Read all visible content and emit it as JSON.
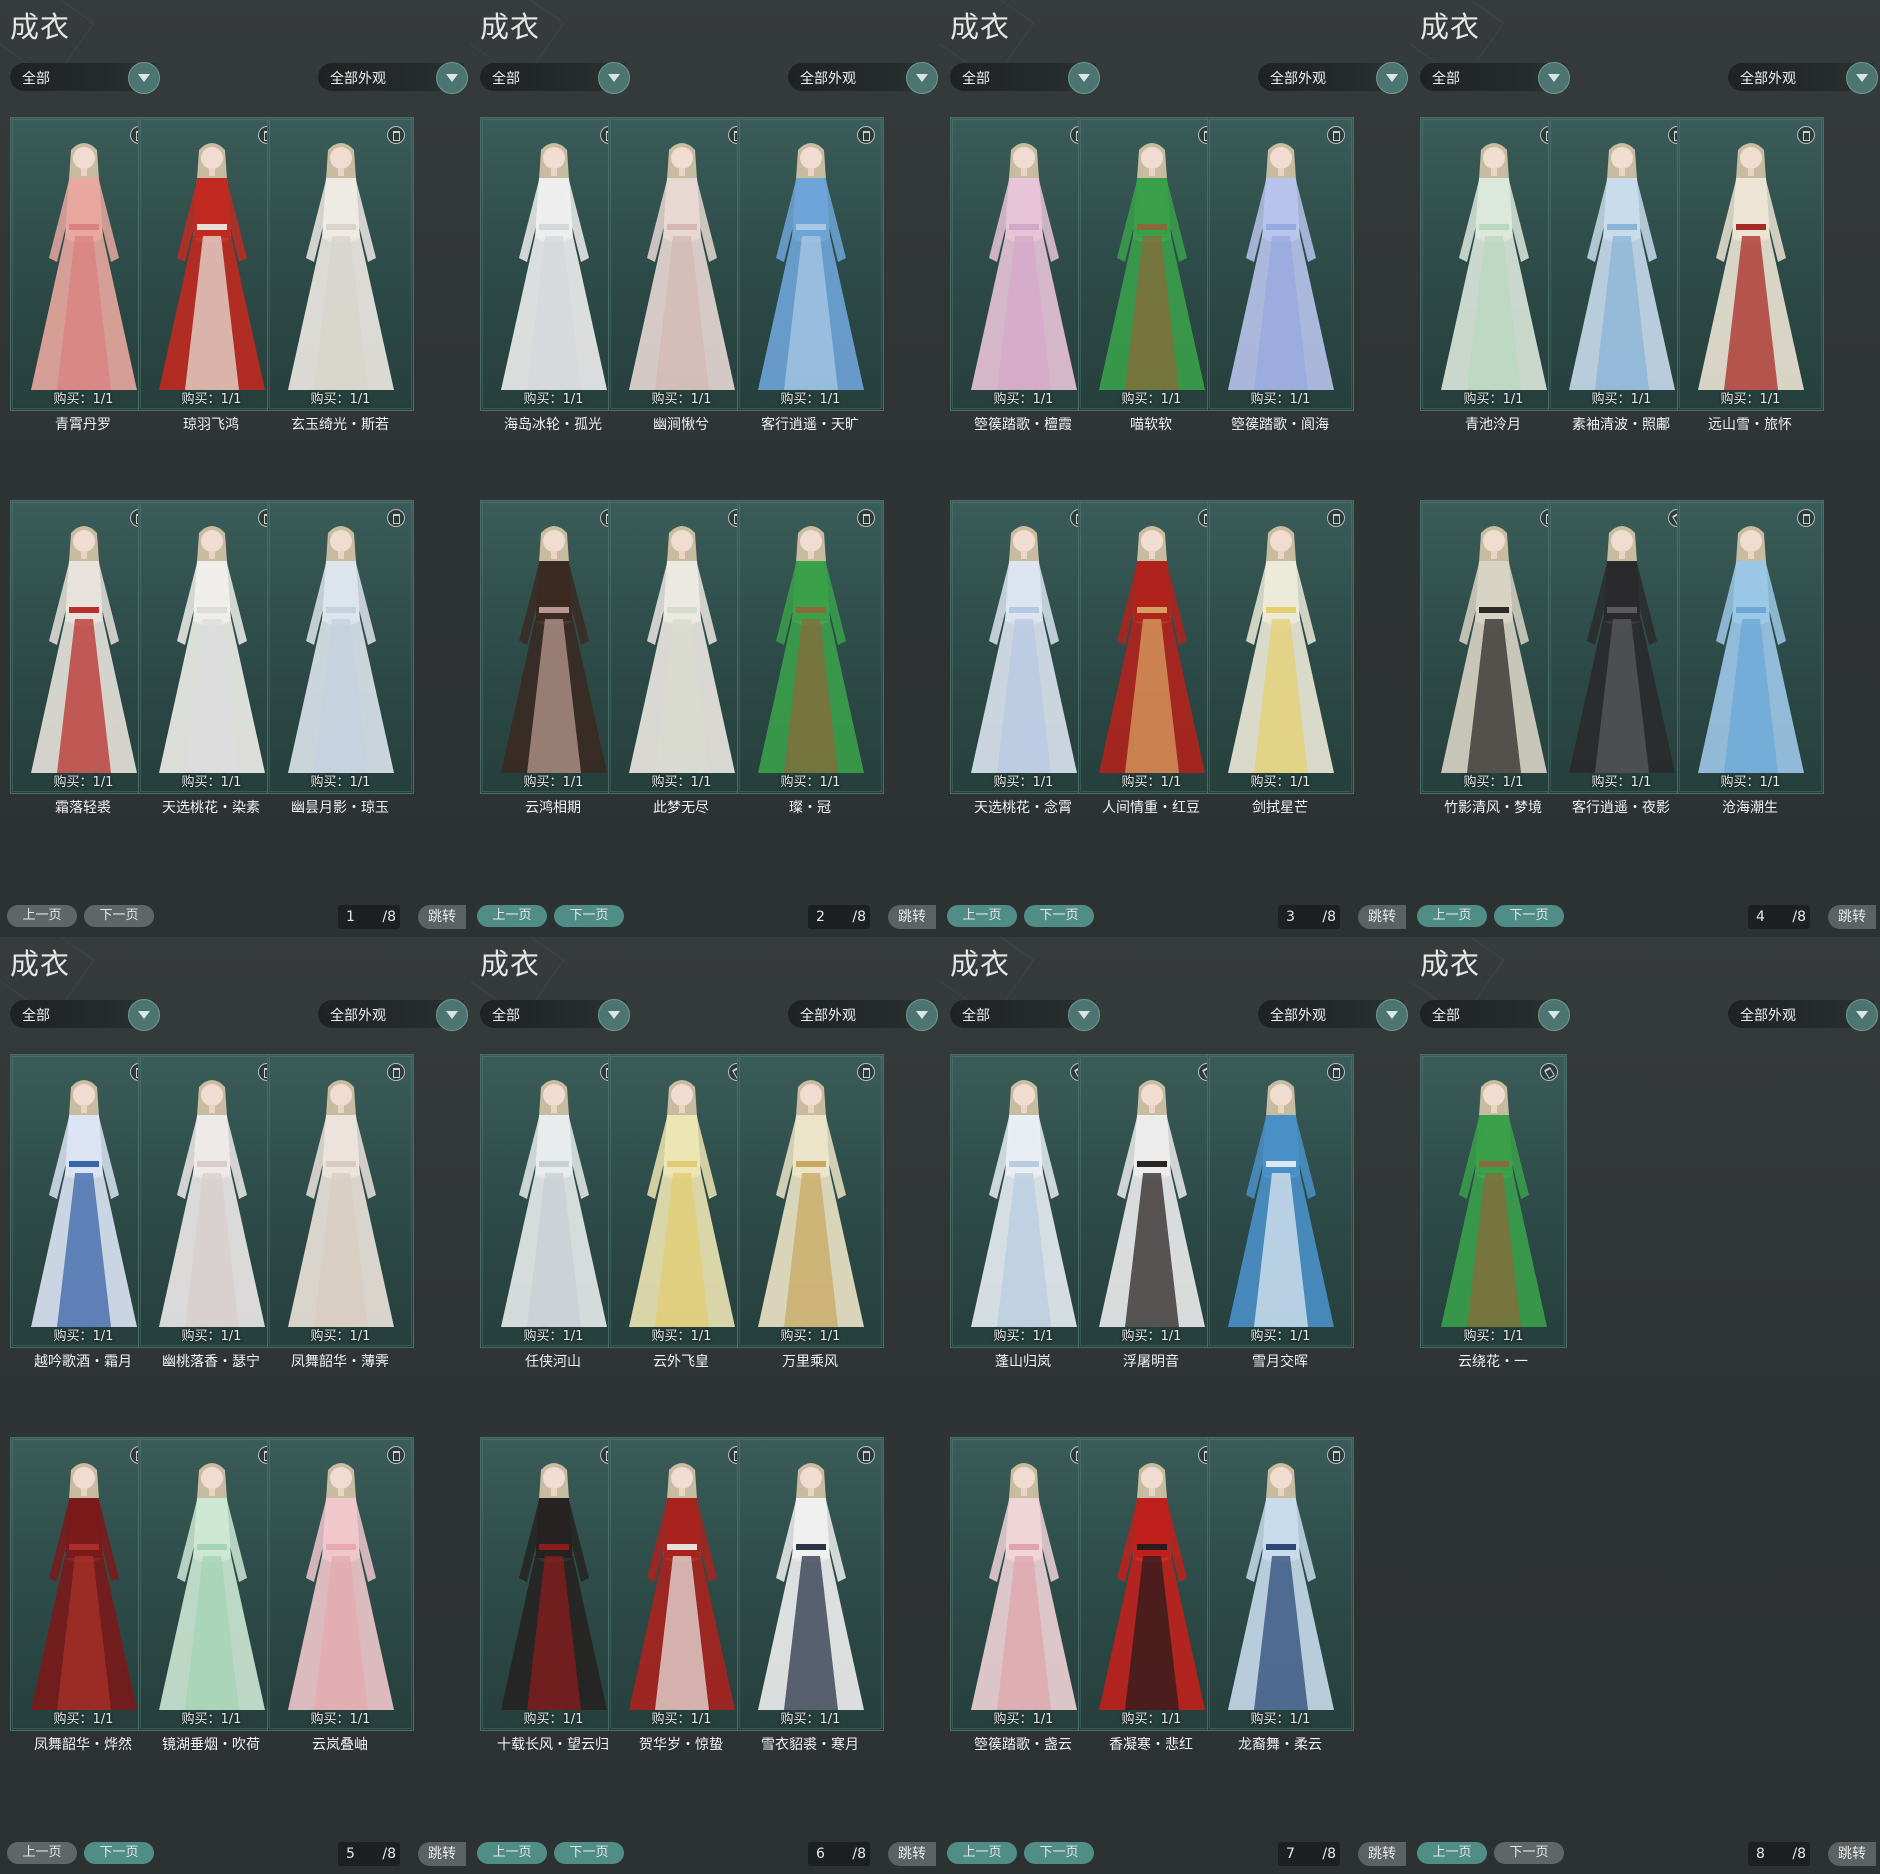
{
  "panels": [
    {
      "title": "成衣",
      "filter_type": "全部",
      "filter_look": "全部外观",
      "page": "1",
      "total": "/8",
      "prev": "上一页",
      "next": "下一页",
      "jump": "跳转",
      "items": [
        {
          "name": "青霄丹罗",
          "buy": "购买：1/1",
          "colors": [
            "#e8a8a0",
            "#d98080"
          ]
        },
        {
          "name": "琼羽飞鸿",
          "buy": "购买：1/1",
          "colors": [
            "#c02a20",
            "#e8e0d8"
          ]
        },
        {
          "name": "玄玉绮光・斯若",
          "buy": "购买：1/1",
          "colors": [
            "#eeeae4",
            "#d8d4cc"
          ]
        },
        {
          "name": "霜落轻裘",
          "buy": "购买：1/1",
          "colors": [
            "#e8e2dc",
            "#b8302c"
          ]
        },
        {
          "name": "天选桃花・染素",
          "buy": "购买：1/1",
          "colors": [
            "#f0eeea",
            "#dcdcdc"
          ]
        },
        {
          "name": "幽昙月影・琼玉",
          "buy": "购买：1/1",
          "colors": [
            "#dce4ec",
            "#c4d2e0"
          ]
        }
      ]
    },
    {
      "title": "成衣",
      "filter_type": "全部",
      "filter_look": "全部外观",
      "page": "2",
      "total": "/8",
      "prev": "上一页",
      "next": "下一页",
      "jump": "跳转",
      "items": [
        {
          "name": "海岛冰轮・孤光",
          "buy": "购买：1/1",
          "colors": [
            "#eeeeee",
            "#d4d8dc"
          ]
        },
        {
          "name": "幽涧愀兮",
          "buy": "购买：1/1",
          "colors": [
            "#e8d8d4",
            "#d4b8b4"
          ]
        },
        {
          "name": "客行逍遥・天旷",
          "buy": "购买：1/1",
          "colors": [
            "#6ea4d8",
            "#a8c8e4"
          ]
        },
        {
          "name": "云鸿相期",
          "buy": "购买：1/1",
          "colors": [
            "#3a2a22",
            "#b89890"
          ]
        },
        {
          "name": "此梦无尽",
          "buy": "购买：1/1",
          "colors": [
            "#ece8e2",
            "#d8dcd0"
          ]
        },
        {
          "name": "璨・冠",
          "buy": "购买：1/1",
          "colors": [
            "#3aa04a",
            "#8a6a3a"
          ]
        }
      ]
    },
    {
      "title": "成衣",
      "filter_type": "全部",
      "filter_look": "全部外观",
      "page": "3",
      "total": "/8",
      "prev": "上一页",
      "next": "下一页",
      "jump": "跳转",
      "items": [
        {
          "name": "箜篌踏歌・檀霞",
          "buy": "购买：1/1",
          "colors": [
            "#e8c4d8",
            "#d4a8c8"
          ]
        },
        {
          "name": "喵软软",
          "buy": "购买：1/1",
          "colors": [
            "#3aa04a",
            "#8a6a3a"
          ]
        },
        {
          "name": "箜篌踏歌・阆海",
          "buy": "购买：1/1",
          "colors": [
            "#b8c4ec",
            "#98a8e0"
          ]
        },
        {
          "name": "天选桃花・念霄",
          "buy": "购买：1/1",
          "colors": [
            "#dce4f0",
            "#b8c8e4"
          ]
        },
        {
          "name": "人间情重・红豆",
          "buy": "购买：1/1",
          "colors": [
            "#b0221c",
            "#d8a060"
          ]
        },
        {
          "name": "剑拭星芒",
          "buy": "购买：1/1",
          "colors": [
            "#ecead8",
            "#e4d070"
          ]
        }
      ]
    },
    {
      "title": "成衣",
      "filter_type": "全部",
      "filter_look": "全部外观",
      "page": "4",
      "total": "/8",
      "prev": "上一页",
      "next": "下一页",
      "jump": "跳转",
      "items": [
        {
          "name": "青池泠月",
          "buy": "购买：1/1",
          "colors": [
            "#dce8dc",
            "#b8d8c0"
          ]
        },
        {
          "name": "素袖清波・照鄘",
          "buy": "购买：1/1",
          "colors": [
            "#c8dcec",
            "#8ab4d8"
          ]
        },
        {
          "name": "远山雪・旅怀",
          "buy": "购买：1/1",
          "colors": [
            "#ece4d4",
            "#a82a24"
          ]
        },
        {
          "name": "竹影清风・梦境",
          "buy": "购买：1/1",
          "colors": [
            "#d8d4c4",
            "#2c2a28"
          ]
        },
        {
          "name": "客行逍遥・夜影",
          "buy": "购买：1/1",
          "colors": [
            "#2a2a2c",
            "#5a5a5c"
          ]
        },
        {
          "name": "沧海潮生",
          "buy": "购买：1/1",
          "colors": [
            "#9cc8e8",
            "#6aa8d8"
          ]
        }
      ]
    },
    {
      "title": "成衣",
      "filter_type": "全部",
      "filter_look": "全部外观",
      "page": "5",
      "total": "/8",
      "prev": "上一页",
      "next": "下一页",
      "jump": "跳转",
      "items": [
        {
          "name": "越吟歌酒・霜月",
          "buy": "购买：1/1",
          "colors": [
            "#dce4f4",
            "#3a64a8"
          ]
        },
        {
          "name": "幽桃落香・瑟宁",
          "buy": "购买：1/1",
          "colors": [
            "#eeeaea",
            "#d8cccc"
          ]
        },
        {
          "name": "凤舞韶华・薄霁",
          "buy": "购买：1/1",
          "colors": [
            "#ece4dc",
            "#d8ccc0"
          ]
        },
        {
          "name": "凤舞韶华・烨然",
          "buy": "购买：1/1",
          "colors": [
            "#7a1a1a",
            "#a83028"
          ]
        },
        {
          "name": "镜湖垂烟・吹荷",
          "buy": "购买：1/1",
          "colors": [
            "#cce8d4",
            "#a4d4b4"
          ]
        },
        {
          "name": "云岚叠岫",
          "buy": "购买：1/1",
          "colors": [
            "#f0c8cc",
            "#e4aab0"
          ]
        }
      ]
    },
    {
      "title": "成衣",
      "filter_type": "全部",
      "filter_look": "全部外观",
      "page": "6",
      "total": "/8",
      "prev": "上一页",
      "next": "下一页",
      "jump": "跳转",
      "items": [
        {
          "name": "任侠河山",
          "buy": "购买：1/1",
          "colors": [
            "#e8ecec",
            "#c8d0d4"
          ]
        },
        {
          "name": "云外飞皇",
          "buy": "购买：1/1",
          "colors": [
            "#ece6b4",
            "#e0cc70"
          ]
        },
        {
          "name": "万里乘风",
          "buy": "购买：1/1",
          "colors": [
            "#ece4c8",
            "#c8a860"
          ]
        },
        {
          "name": "十载长风・望云归",
          "buy": "购买：1/1",
          "colors": [
            "#262222",
            "#8a1c1c"
          ]
        },
        {
          "name": "贺华岁・惊蛰",
          "buy": "购买：1/1",
          "colors": [
            "#a8221e",
            "#e8e0dc"
          ]
        },
        {
          "name": "雪衣貂裘・寒月",
          "buy": "购买：1/1",
          "colors": [
            "#f0f0f0",
            "#2c3448"
          ]
        }
      ]
    },
    {
      "title": "成衣",
      "filter_type": "全部",
      "filter_look": "全部外观",
      "page": "7",
      "total": "/8",
      "prev": "上一页",
      "next": "下一页",
      "jump": "跳转",
      "items": [
        {
          "name": "蓬山归岚",
          "buy": "购买：1/1",
          "colors": [
            "#e8eef4",
            "#b8cce0"
          ]
        },
        {
          "name": "浮屠明音",
          "buy": "购买：1/1",
          "colors": [
            "#ececec",
            "#2a2624"
          ]
        },
        {
          "name": "雪月交晖",
          "buy": "购买：1/1",
          "colors": [
            "#4a90c8",
            "#dce8f0"
          ]
        },
        {
          "name": "箜篌踏歌・盏云",
          "buy": "购买：1/1",
          "colors": [
            "#f0d4d8",
            "#e0a4ac"
          ]
        },
        {
          "name": "香凝寒・悲红",
          "buy": "购买：1/1",
          "colors": [
            "#c0201c",
            "#2a1c1c"
          ]
        },
        {
          "name": "龙裔舞・柔云",
          "buy": "购买：1/1",
          "colors": [
            "#c8dcec",
            "#2c4a78"
          ]
        }
      ]
    },
    {
      "title": "成衣",
      "filter_type": "全部",
      "filter_look": "全部外观",
      "page": "8",
      "total": "/8",
      "prev": "上一页",
      "next": "下一页",
      "jump": "跳转",
      "items": [
        {
          "name": "云绕花・一",
          "buy": "购买：1/1",
          "colors": [
            "#3aa04a",
            "#8a6a3a"
          ]
        }
      ]
    }
  ]
}
